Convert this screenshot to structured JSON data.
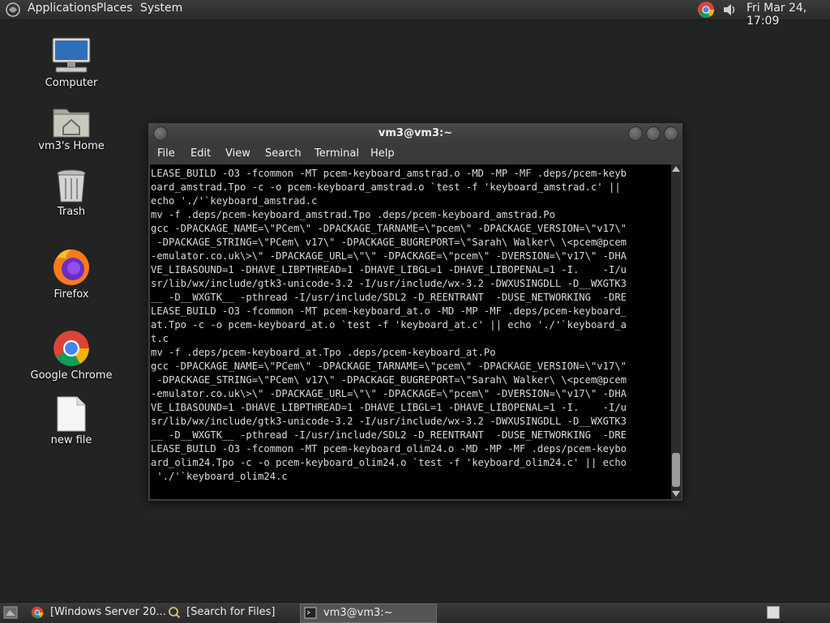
{
  "top_panel": {
    "menus": [
      "Applications",
      "Places",
      "System"
    ],
    "clock": "Fri Mar 24, 17:09"
  },
  "desktop_icons": [
    {
      "label": "Computer",
      "icon": "computer-icon"
    },
    {
      "label": "vm3's Home",
      "icon": "home-folder-icon"
    },
    {
      "label": "Trash",
      "icon": "trash-icon"
    },
    {
      "label": "Firefox",
      "icon": "firefox-icon"
    },
    {
      "label": "Google Chrome",
      "icon": "chrome-icon"
    },
    {
      "label": "new file",
      "icon": "file-icon"
    }
  ],
  "terminal": {
    "title": "vm3@vm3:~",
    "menu": [
      "File",
      "Edit",
      "View",
      "Search",
      "Terminal",
      "Help"
    ],
    "lines": [
      "LEASE_BUILD -O3 -fcommon -MT pcem-keyboard_amstrad.o -MD -MP -MF .deps/pcem-keyb",
      "oard_amstrad.Tpo -c -o pcem-keyboard_amstrad.o `test -f 'keyboard_amstrad.c' ||",
      "echo './'`keyboard_amstrad.c",
      "mv -f .deps/pcem-keyboard_amstrad.Tpo .deps/pcem-keyboard_amstrad.Po",
      "gcc -DPACKAGE_NAME=\\\"PCem\\\" -DPACKAGE_TARNAME=\\\"pcem\\\" -DPACKAGE_VERSION=\\\"v17\\\"",
      " -DPACKAGE_STRING=\\\"PCem\\ v17\\\" -DPACKAGE_BUGREPORT=\\\"Sarah\\ Walker\\ \\<pcem@pcem",
      "-emulator.co.uk\\>\\\" -DPACKAGE_URL=\\\"\\\" -DPACKAGE=\\\"pcem\\\" -DVERSION=\\\"v17\\\" -DHA",
      "VE_LIBASOUND=1 -DHAVE_LIBPTHREAD=1 -DHAVE_LIBGL=1 -DHAVE_LIBOPENAL=1 -I.    -I/u",
      "sr/lib/wx/include/gtk3-unicode-3.2 -I/usr/include/wx-3.2 -DWXUSINGDLL -D__WXGTK3",
      "__ -D__WXGTK__ -pthread -I/usr/include/SDL2 -D_REENTRANT  -DUSE_NETWORKING  -DRE",
      "LEASE_BUILD -O3 -fcommon -MT pcem-keyboard_at.o -MD -MP -MF .deps/pcem-keyboard_",
      "at.Tpo -c -o pcem-keyboard_at.o `test -f 'keyboard_at.c' || echo './'`keyboard_a",
      "t.c",
      "mv -f .deps/pcem-keyboard_at.Tpo .deps/pcem-keyboard_at.Po",
      "gcc -DPACKAGE_NAME=\\\"PCem\\\" -DPACKAGE_TARNAME=\\\"pcem\\\" -DPACKAGE_VERSION=\\\"v17\\\"",
      " -DPACKAGE_STRING=\\\"PCem\\ v17\\\" -DPACKAGE_BUGREPORT=\\\"Sarah\\ Walker\\ \\<pcem@pcem",
      "-emulator.co.uk\\>\\\" -DPACKAGE_URL=\\\"\\\" -DPACKAGE=\\\"pcem\\\" -DVERSION=\\\"v17\\\" -DHA",
      "VE_LIBASOUND=1 -DHAVE_LIBPTHREAD=1 -DHAVE_LIBGL=1 -DHAVE_LIBOPENAL=1 -I.    -I/u",
      "sr/lib/wx/include/gtk3-unicode-3.2 -I/usr/include/wx-3.2 -DWXUSINGDLL -D__WXGTK3",
      "__ -D__WXGTK__ -pthread -I/usr/include/SDL2 -D_REENTRANT  -DUSE_NETWORKING  -DRE",
      "LEASE_BUILD -O3 -fcommon -MT pcem-keyboard_olim24.o -MD -MP -MF .deps/pcem-keybo",
      "ard_olim24.Tpo -c -o pcem-keyboard_olim24.o `test -f 'keyboard_olim24.c' || echo",
      " './'`keyboard_olim24.c"
    ]
  },
  "taskbar": {
    "tasks": [
      {
        "label": "[Windows Server 20...",
        "icon": "chrome-icon"
      },
      {
        "label": "[Search for Files]",
        "icon": "search-icon"
      },
      {
        "label": "vm3@vm3:~",
        "icon": "terminal-icon"
      }
    ]
  },
  "colors": {
    "desktop": "#222323",
    "panel": "#333333",
    "terminal_bg": "#000000",
    "terminal_fg": "#dcdcdc"
  }
}
